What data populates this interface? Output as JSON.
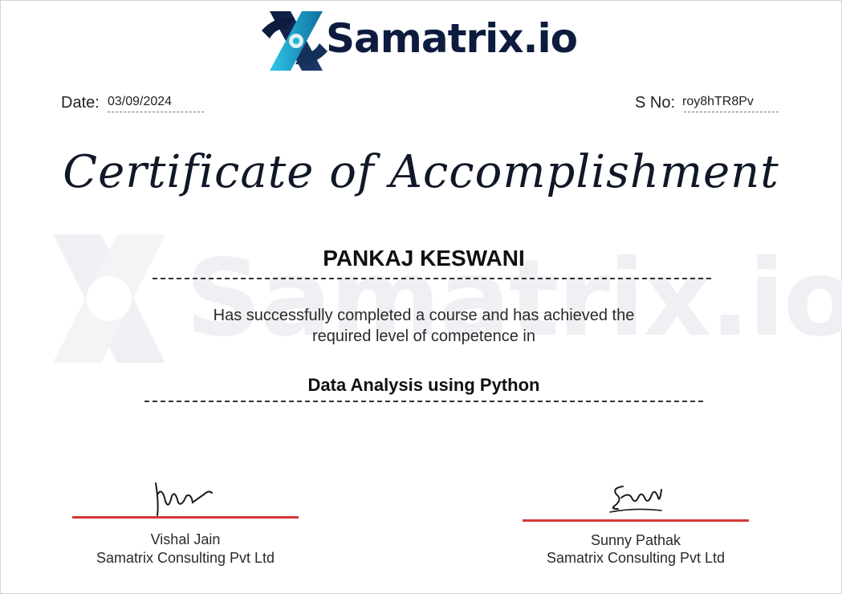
{
  "logo": {
    "text": "Samatrix.io"
  },
  "watermark": {
    "text": "Samatrix.io"
  },
  "meta": {
    "date_label": "Date:",
    "date_value": "03/09/2024",
    "serial_label": "S No:",
    "serial_value": "roy8hTR8Pv"
  },
  "certificate": {
    "title": "Certificate of Accomplishment",
    "recipient": "PANKAJ KESWANI",
    "statement_line1": "Has successfully completed a course and has achieved the",
    "statement_line2": "required level of competence in",
    "course": "Data Analysis using Python"
  },
  "signatories": [
    {
      "name": "Vishal Jain",
      "company": "Samatrix Consulting Pvt Ltd"
    },
    {
      "name": "Sunny Pathak",
      "company": "Samatrix Consulting Pvt Ltd"
    }
  ],
  "colors": {
    "brand_navy": "#0d1b3e",
    "brand_cyan": "#1fb4d8",
    "signature_line": "#d63737",
    "watermark": "#eef0f3"
  }
}
